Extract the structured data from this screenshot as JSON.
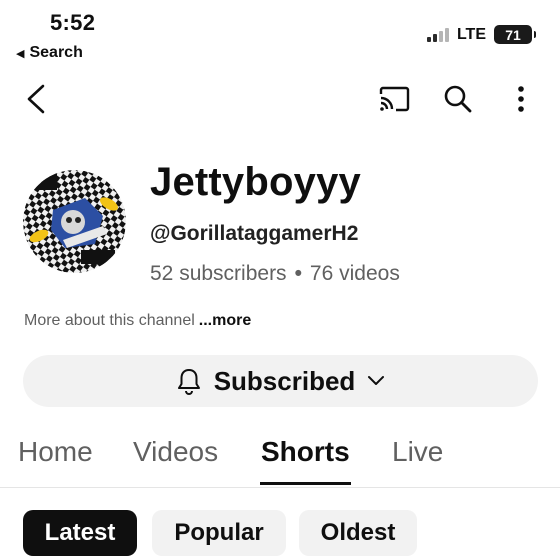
{
  "status_bar": {
    "time": "5:52",
    "back_app": "Search",
    "network": "LTE",
    "battery": "71"
  },
  "nav": {
    "icons": [
      "back-icon",
      "cast-icon",
      "search-icon",
      "more-vert-icon"
    ]
  },
  "channel": {
    "name": "Jettyboyyy",
    "handle": "@GorillataggamerH2",
    "subscribers": "52 subscribers",
    "separator": "•",
    "videos": "76 videos",
    "about_prefix": "More about this channel",
    "about_more": "...more"
  },
  "subscribe_button": {
    "label": "Subscribed"
  },
  "tabs": [
    {
      "label": "Home"
    },
    {
      "label": "Videos"
    },
    {
      "label": "Shorts"
    },
    {
      "label": "Live"
    }
  ],
  "active_tab": "Shorts",
  "filters": [
    {
      "label": "Latest"
    },
    {
      "label": "Popular"
    },
    {
      "label": "Oldest"
    }
  ],
  "selected_filter": "Latest",
  "colors": {
    "text_primary": "#0f0f0f",
    "text_secondary": "#606060",
    "button_bg": "#f2f2f2",
    "chip_selected_bg": "#0f0f0f"
  }
}
